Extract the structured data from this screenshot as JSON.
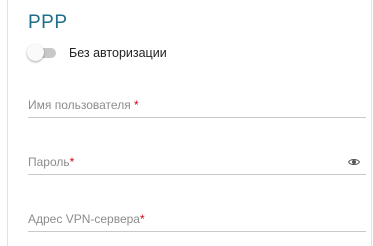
{
  "section": {
    "title": "PPP"
  },
  "toggle": {
    "label": "Без авторизации",
    "state": "off"
  },
  "fields": {
    "username": {
      "label": "Имя пользователя",
      "required_mark": " *",
      "value": ""
    },
    "password": {
      "label": "Пароль",
      "required_mark": "*",
      "value": "",
      "icon": "eye-icon"
    },
    "vpn_server": {
      "label": "Адрес VPN-сервера",
      "required_mark": "*",
      "value": ""
    }
  },
  "colors": {
    "title": "#1c6e8a",
    "required": "#d0021b",
    "toggle_track": "#c8c8c8"
  }
}
